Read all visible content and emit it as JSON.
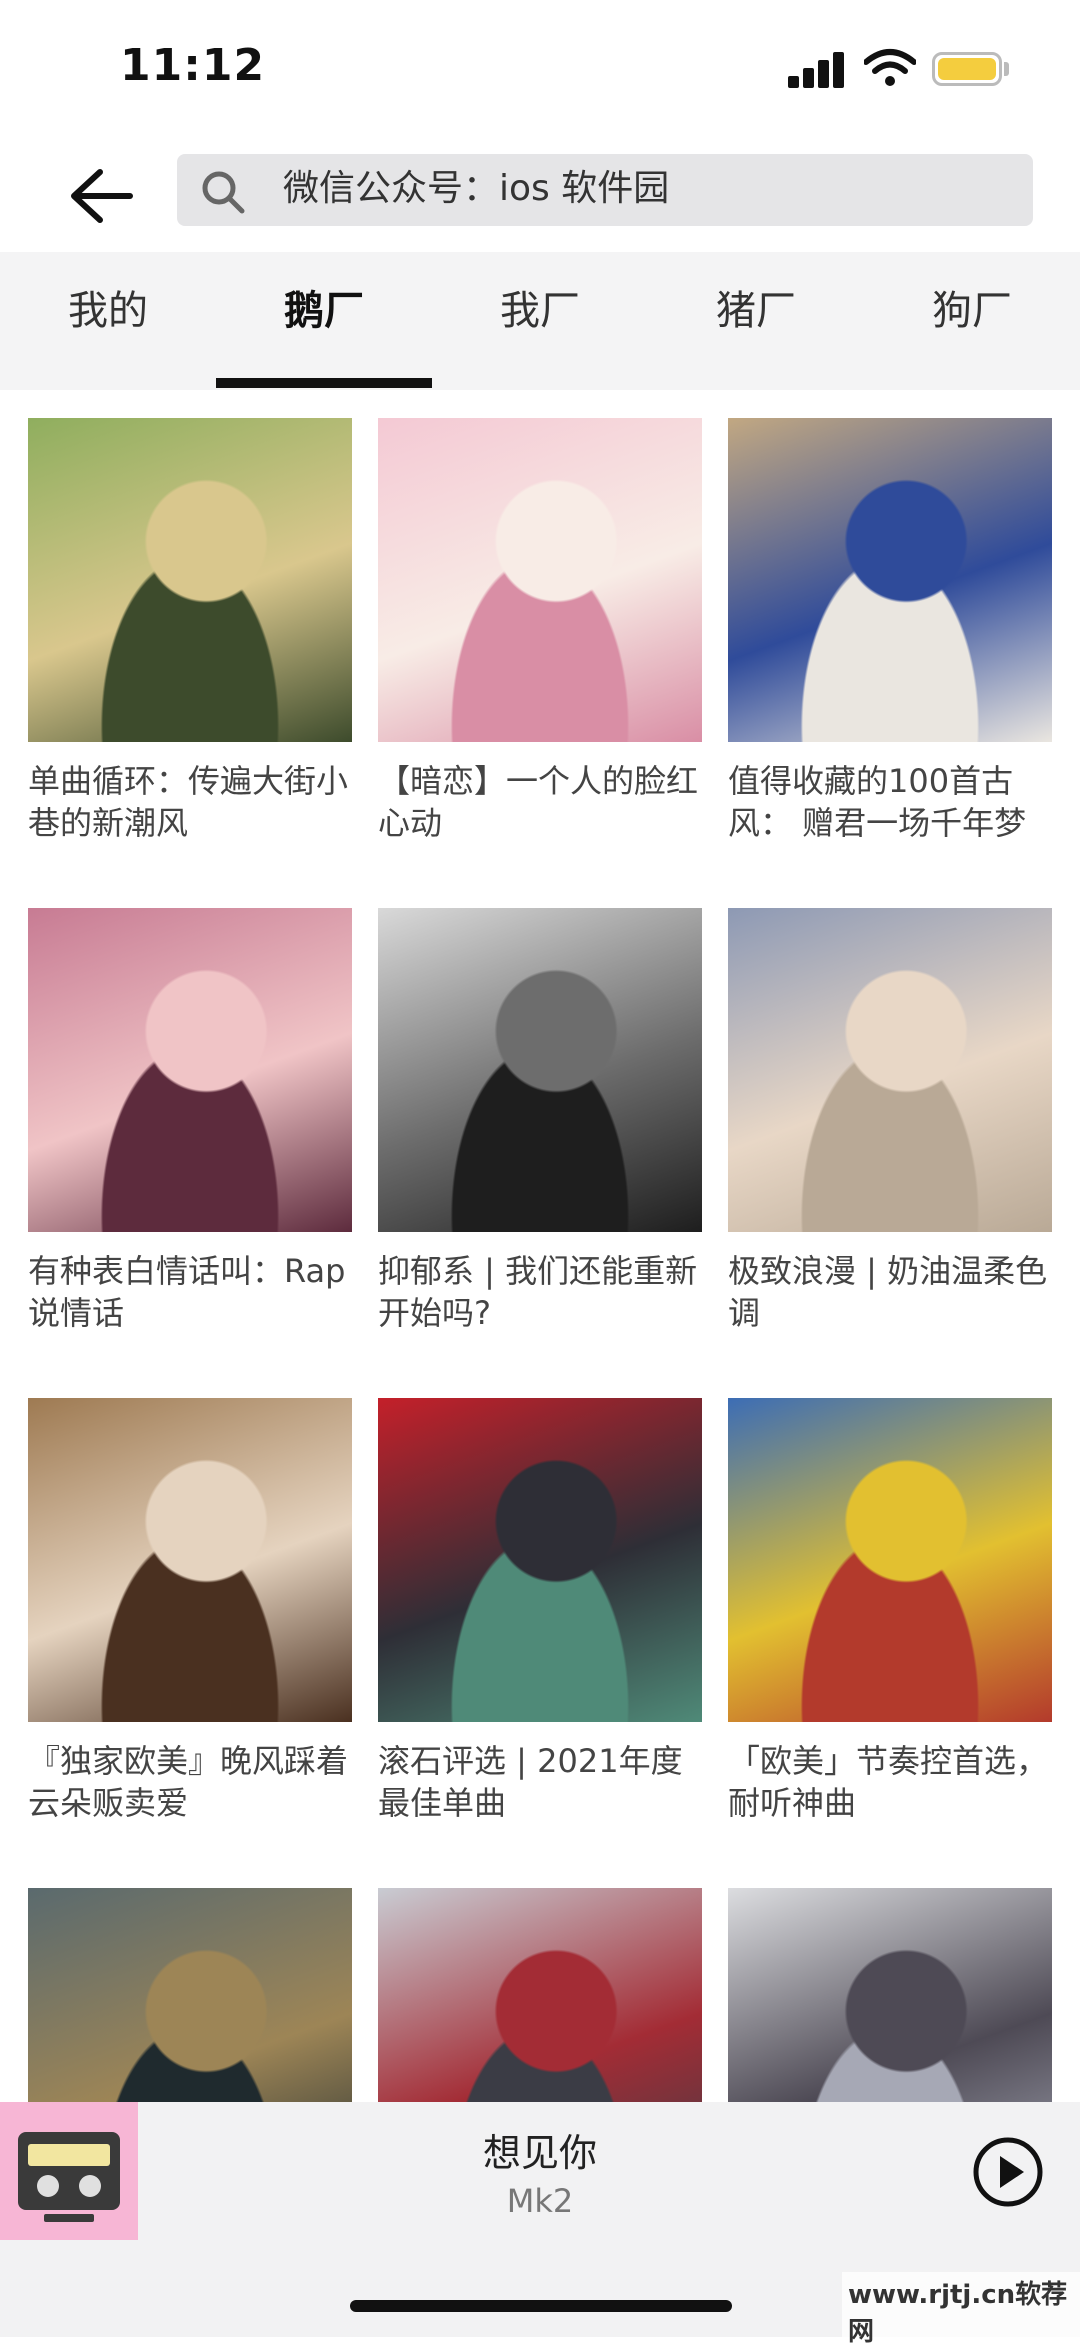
{
  "status_bar": {
    "time": "11:12"
  },
  "search": {
    "text": "微信公众号：ios 软件园"
  },
  "tabs": [
    {
      "label": "我的",
      "active": false
    },
    {
      "label": "鹅厂",
      "active": true
    },
    {
      "label": "我厂",
      "active": false
    },
    {
      "label": "猪厂",
      "active": false
    },
    {
      "label": "狗厂",
      "active": false
    }
  ],
  "playlists": [
    {
      "title": "单曲循环：传遍大街小巷的新潮风",
      "palette": [
        "#8fae5e",
        "#d9c78d",
        "#3d4b2c"
      ]
    },
    {
      "title": "【暗恋】一个人的脸红心动",
      "palette": [
        "#f4c9d4",
        "#f8ece6",
        "#d98ea5"
      ]
    },
    {
      "title": "值得收藏的100首古风： 赠君一场千年梦",
      "palette": [
        "#c2a882",
        "#2f4b9a",
        "#eae6e0"
      ]
    },
    {
      "title": "有种表白情话叫：Rap说情话",
      "palette": [
        "#c77b93",
        "#f0c4c6",
        "#5d2b3d"
      ]
    },
    {
      "title": "抑郁系 | 我们还能重新开始吗?",
      "palette": [
        "#d9d9d9",
        "#6d6d6d",
        "#1e1e1e"
      ]
    },
    {
      "title": "极致浪漫 | 奶油温柔色调",
      "palette": [
        "#8d99b4",
        "#e8d7c6",
        "#b9a996"
      ]
    },
    {
      "title": "『独家欧美』晚风踩着云朵贩卖爱",
      "palette": [
        "#9e7a52",
        "#e5d3bf",
        "#4a3020"
      ]
    },
    {
      "title": "滚石评选 | 2021年度最佳单曲",
      "palette": [
        "#c4202a",
        "#2e2e36",
        "#4f8a78"
      ]
    },
    {
      "title": "「欧美」节奏控首选，耐听神曲",
      "palette": [
        "#3c6db5",
        "#e2c030",
        "#b33a2c"
      ]
    },
    {
      "title": "",
      "palette": [
        "#5a6a6e",
        "#9d8556",
        "#1f2a2e"
      ]
    },
    {
      "title": "",
      "palette": [
        "#c9ccd3",
        "#a32c35",
        "#3b3c45"
      ]
    },
    {
      "title": "",
      "palette": [
        "#dcdde0",
        "#4e4a55",
        "#a6a8b5"
      ]
    }
  ],
  "now_playing": {
    "title": "想见你",
    "artist": "Mk2",
    "cover_color": "#f7b6d5"
  },
  "watermark": "www.rjtj.cn软荐网",
  "colors": {
    "battery": "#f4cd3e",
    "tab_bar_bg": "#f4f4f5",
    "search_bg": "#e5e5e7"
  }
}
